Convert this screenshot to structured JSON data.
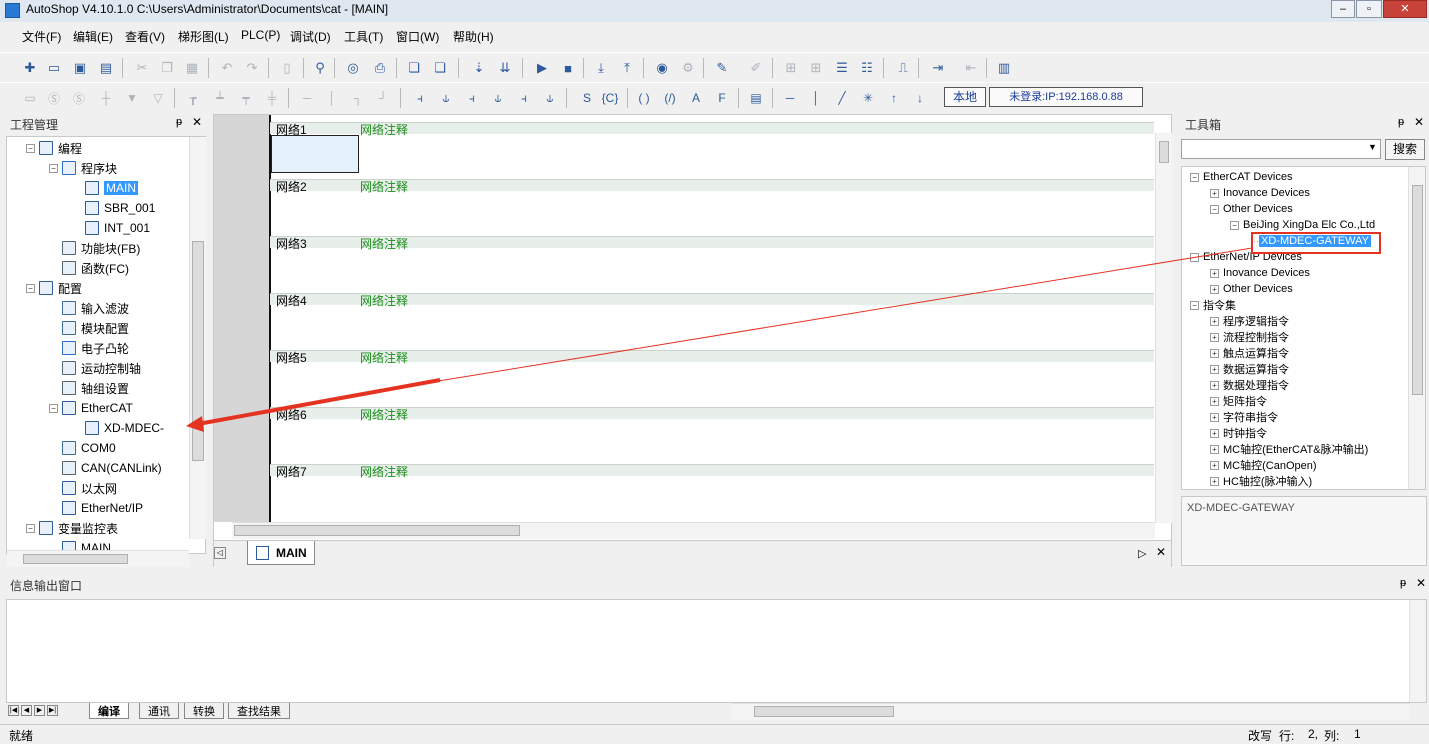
{
  "title": "AutoShop V4.10.1.0  C:\\Users\\Administrator\\Documents\\cat - [MAIN]",
  "menu": [
    "文件(F)",
    "编辑(E)",
    "查看(V)",
    "梯形图(L)",
    "PLC(P)",
    "调试(D)",
    "工具(T)",
    "窗口(W)",
    "帮助(H)"
  ],
  "toolbar": {
    "local_label": "本地",
    "conn_label": "未登录:IP:192.168.0.88"
  },
  "project": {
    "header": "工程管理",
    "items": [
      {
        "label": "编程",
        "indent": 0,
        "pm": "−"
      },
      {
        "label": "程序块",
        "indent": 1,
        "pm": "−"
      },
      {
        "label": "MAIN",
        "indent": 2,
        "selected": true
      },
      {
        "label": "SBR_001",
        "indent": 2
      },
      {
        "label": "INT_001",
        "indent": 2
      },
      {
        "label": "功能块(FB)",
        "indent": 1
      },
      {
        "label": "函数(FC)",
        "indent": 1
      },
      {
        "label": "配置",
        "indent": 0,
        "pm": "−"
      },
      {
        "label": "输入滤波",
        "indent": 1
      },
      {
        "label": "模块配置",
        "indent": 1
      },
      {
        "label": "电子凸轮",
        "indent": 1
      },
      {
        "label": "运动控制轴",
        "indent": 1
      },
      {
        "label": "轴组设置",
        "indent": 1
      },
      {
        "label": "EtherCAT",
        "indent": 1,
        "pm": "−"
      },
      {
        "label": "XD-MDEC-",
        "indent": 2
      },
      {
        "label": "COM0",
        "indent": 1
      },
      {
        "label": "CAN(CANLink)",
        "indent": 1
      },
      {
        "label": "以太网",
        "indent": 1
      },
      {
        "label": "EtherNet/IP",
        "indent": 1
      },
      {
        "label": "变量监控表",
        "indent": 0,
        "pm": "−"
      },
      {
        "label": "MAIN",
        "indent": 1
      }
    ]
  },
  "editor": {
    "networks": [
      {
        "label": "网络1",
        "comment": "网络注释"
      },
      {
        "label": "网络2",
        "comment": "网络注释"
      },
      {
        "label": "网络3",
        "comment": "网络注释"
      },
      {
        "label": "网络4",
        "comment": "网络注释"
      },
      {
        "label": "网络5",
        "comment": "网络注释"
      },
      {
        "label": "网络6",
        "comment": "网络注释"
      },
      {
        "label": "网络7",
        "comment": "网络注释"
      }
    ],
    "tab": "MAIN"
  },
  "toolbox": {
    "header": "工具箱",
    "search": "搜索",
    "items": [
      {
        "label": "EtherCAT Devices",
        "indent": 0,
        "pm": "−"
      },
      {
        "label": "Inovance Devices",
        "indent": 1,
        "pm": "+"
      },
      {
        "label": "Other Devices",
        "indent": 1,
        "pm": "−"
      },
      {
        "label": "BeiJing XingDa Elc Co.,Ltd",
        "indent": 2,
        "pm": "−"
      },
      {
        "label": "XD-MDEC-GATEWAY",
        "indent": 3,
        "selected": true
      },
      {
        "label": "EtherNet/IP Devices",
        "indent": 0,
        "pm": "−"
      },
      {
        "label": "Inovance Devices",
        "indent": 1,
        "pm": "+"
      },
      {
        "label": "Other Devices",
        "indent": 1,
        "pm": "+"
      },
      {
        "label": "指令集",
        "indent": 0,
        "pm": "−"
      },
      {
        "label": "程序逻辑指令",
        "indent": 1,
        "pm": "+"
      },
      {
        "label": "流程控制指令",
        "indent": 1,
        "pm": "+"
      },
      {
        "label": "触点运算指令",
        "indent": 1,
        "pm": "+"
      },
      {
        "label": "数据运算指令",
        "indent": 1,
        "pm": "+"
      },
      {
        "label": "数据处理指令",
        "indent": 1,
        "pm": "+"
      },
      {
        "label": "矩阵指令",
        "indent": 1,
        "pm": "+"
      },
      {
        "label": "字符串指令",
        "indent": 1,
        "pm": "+"
      },
      {
        "label": "时钟指令",
        "indent": 1,
        "pm": "+"
      },
      {
        "label": "MC轴控(EtherCAT&脉冲输出)",
        "indent": 1,
        "pm": "+"
      },
      {
        "label": "MC轴控(CanOpen)",
        "indent": 1,
        "pm": "+"
      },
      {
        "label": "HC轴控(脉冲输入)",
        "indent": 1,
        "pm": "+"
      }
    ],
    "description": "XD-MDEC-GATEWAY"
  },
  "output": {
    "header": "信息输出窗口",
    "tabs": [
      "编译",
      "通讯",
      "转换",
      "查找结果"
    ]
  },
  "status": {
    "ready": "就绪",
    "mode": "改写",
    "row_label": "行:",
    "row": "2,",
    "col_label": "列:",
    "col": "1"
  }
}
